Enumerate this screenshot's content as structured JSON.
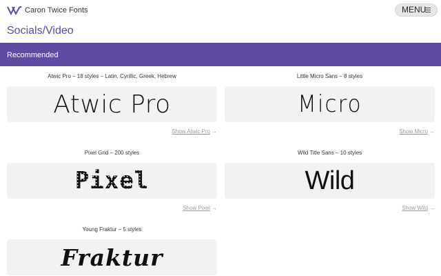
{
  "header": {
    "brand": "Caron Twice Fonts",
    "menu_label": "MENU",
    "logo_icon": "cv-monogram-icon",
    "accent_color": "#5e4ba2"
  },
  "page": {
    "title": "Socials/Video"
  },
  "section": {
    "label": "Recommended"
  },
  "cards": [
    {
      "meta": "Atwic Pro – 18 styles – Latin, Cyrillic, Greek, Hebrew",
      "sample": "Atwic Pro",
      "link": "Show Atwic Pro"
    },
    {
      "meta": "Little Micro Sans – 8 styles",
      "sample": "Micro",
      "link": "Show Micro"
    },
    {
      "meta": "Pixel Grid – 200 styles",
      "sample": "Pixel",
      "link": "Show Pixel"
    },
    {
      "meta": "Wild Title Sans – 10 styles",
      "sample": "Wild",
      "link": "Show Wild"
    },
    {
      "meta": "Young Fraktur – 5 styles",
      "sample": "Fraktur"
    }
  ]
}
